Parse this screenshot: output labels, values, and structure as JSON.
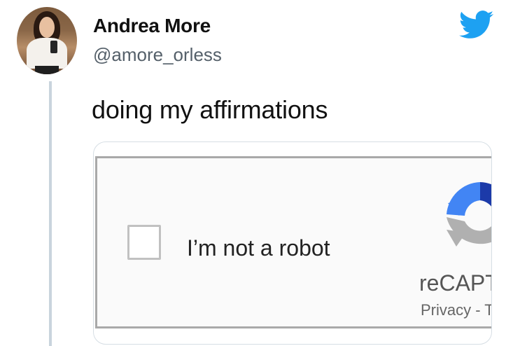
{
  "tweet": {
    "author": {
      "name": "Andrea More",
      "handle": "@amore_orless",
      "avatar_icon": "profile-photo"
    },
    "text": "doing my affirmations",
    "platform_icon": "twitter-bird-icon",
    "brand_color": "#1DA1F2"
  },
  "captcha": {
    "checkbox_checked": false,
    "label": "I’m not a robot",
    "brand": "reCAPT",
    "links": "Privacy - T",
    "logo_icon": "recaptcha-logo-icon",
    "colors": {
      "blue_dark": "#1c3aa9",
      "blue": "#4285f4",
      "gray": "#b0b0b0"
    }
  }
}
